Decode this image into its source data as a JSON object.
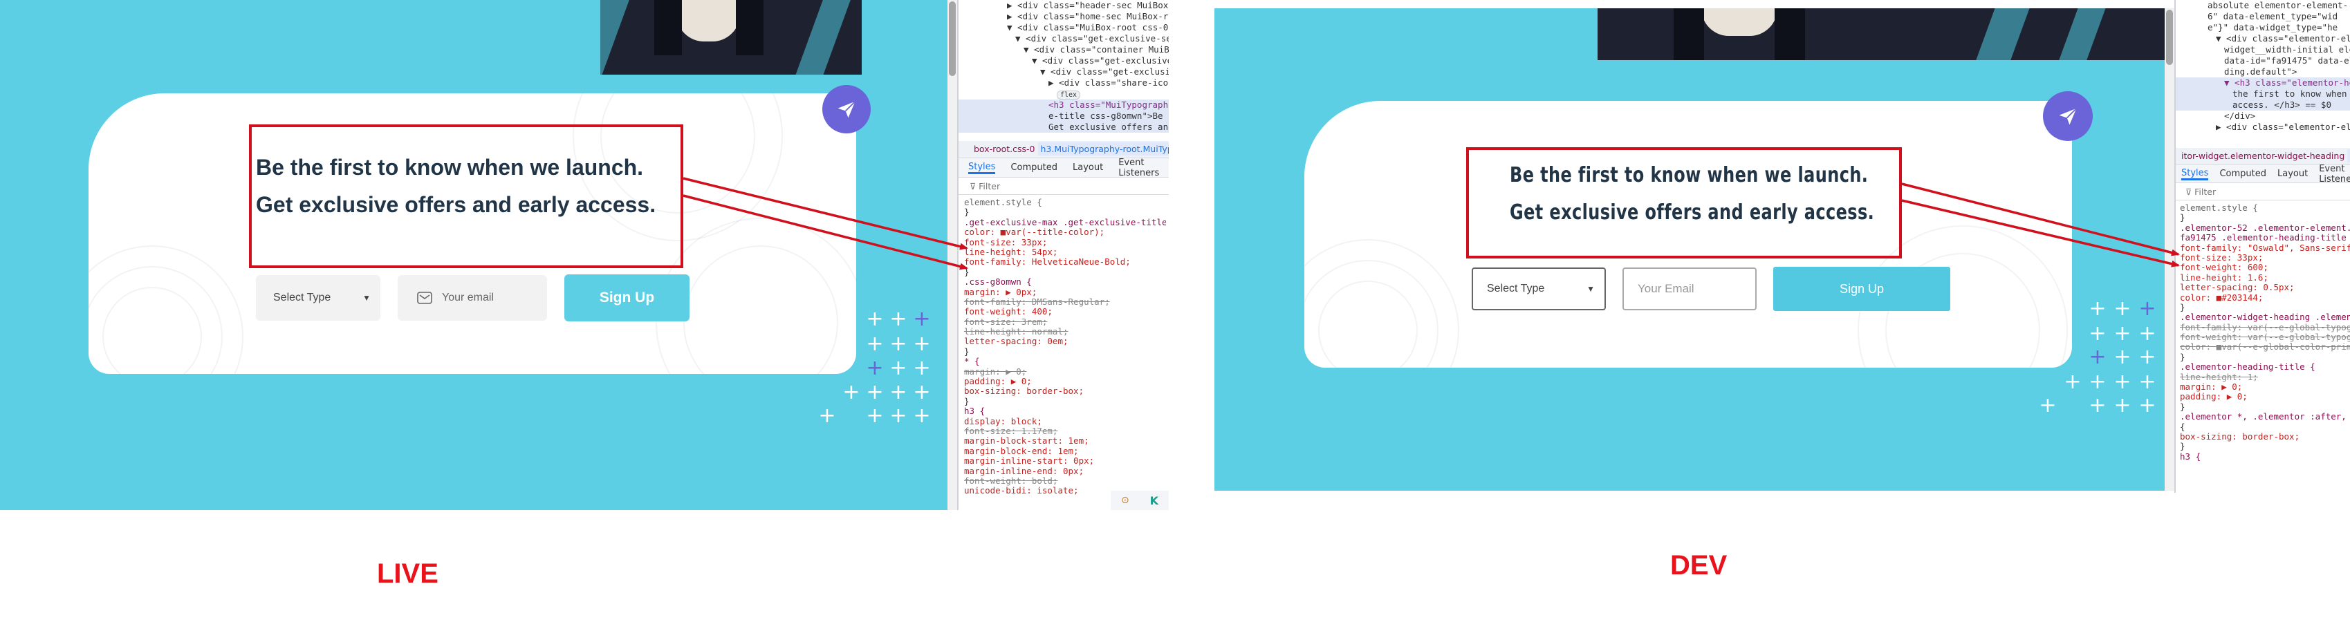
{
  "colors": {
    "hero_bg": "#5ccfe4",
    "accent_purple": "#6b63d8",
    "signup_live": "#5ccfe4",
    "signup_dev": "#53c9e1",
    "annotation_red": "#d0101c",
    "headline": "#213547"
  },
  "live": {
    "caption": "LIVE",
    "headline_line1": "Be the first to know when we launch.",
    "headline_line2": "Get exclusive offers and early access.",
    "select_label": "Select Type",
    "email_placeholder": "Your email",
    "signup_label": "Sign Up",
    "share_icon": "paper-plane-icon",
    "devtools": {
      "dom_lines": [
        "▶ <div class=\"header-sec MuiBox-root",
        "▶ <div class=\"home-sec MuiBox-root c",
        "▼ <div class=\"MuiBox-root css-0\" id=",
        "▼ <div class=\"get-exclusive-sec Mu",
        "▼ <div class=\"container MuiBox-ro",
        "▼ <div class=\"get-exclusive-m",
        "▼ <div class=\"get-exclusive-",
        "▶ <div class=\"share-icon-bo",
        "flex",
        "<h3 class=\"MuiTypography-",
        "e-title css-g8omwn\">Be th",
        "Get exclusive offers and"
      ],
      "crumb_left": "box-root.css-0",
      "crumb_right": "h3.MuiTypography-root.MuiTypogr",
      "tabs": [
        "Styles",
        "Computed",
        "Layout",
        "Event Listeners"
      ],
      "filter_label": "Filter",
      "style_lines": [
        "element.style {",
        "}",
        ".get-exclusive-max .get-exclusive-title {",
        "  color: ■var(--title-color);",
        "  font-size: 33px;",
        "  line-height: 54px;",
        "  font-family: HelveticaNeue-Bold;",
        "}",
        ".css-g8omwn {",
        "  margin: ▶ 0px;",
        "  font-family: DMSans-Regular;",
        "  font-weight: 400;",
        "  font-size: 3rem;",
        "  line-height: normal;",
        "  letter-spacing: 0em;",
        "}",
        "* {",
        "  margin: ▶ 0;",
        "  padding: ▶ 0;",
        "  box-sizing: border-box;",
        "}",
        "h3 {",
        "  display: block;",
        "  font-size: 1.17em;",
        "  margin-block-start: 1em;",
        "  margin-block-end: 1em;",
        "  margin-inline-start: 0px;",
        "  margin-inline-end: 0px;",
        "  font-weight: bold;",
        "  unicode-bidi: isolate;"
      ]
    }
  },
  "dev": {
    "caption": "DEV",
    "headline_line1": "Be the first to know when we launch.",
    "headline_line2": "Get exclusive offers and early access.",
    "select_label": "Select Type",
    "email_placeholder": "Your Email",
    "signup_label": "Sign Up",
    "share_icon": "paper-plane-icon",
    "devtools": {
      "dom_lines": [
        "absolute elementor-element-",
        "6\" data-element_type=\"wid",
        "e\"}\" data-widget_type=\"he",
        "▼ <div class=\"elementor-ele",
        "widget__width-initial ele",
        "data-id=\"fa91475\" data-el",
        "ding.default\">",
        "▼ <h3 class=\"elementor-head",
        "the first to know when w",
        "access. </h3> == $0",
        "</div>",
        "▶ <div class=\"elementor-ele"
      ],
      "crumb_left": "itor-widget.elementor-widget-heading",
      "crumb_right": "h3",
      "tabs": [
        "Styles",
        "Computed",
        "Layout",
        "Event Listeners"
      ],
      "filter_label": "Filter",
      "style_lines": [
        "element.style {",
        "}",
        ".elementor-52 .elementor-element.eleme",
        "fa91475 .elementor-heading-title {",
        "  font-family: \"Oswald\", Sans-serif;",
        "  font-size: 33px;",
        "  font-weight: 600;",
        "  line-height: 1.6;",
        "  letter-spacing: 0.5px;",
        "  color: ■#203144;",
        "}",
        ".elementor-widget-heading .elementor-h",
        "  font-family: var(--e-global-typogra",
        "  font-weight: var(--e-global-typogra",
        "  color: ■var(--e-global-color-primar",
        "}",
        ".elementor-heading-title {",
        "  line-height: 1;",
        "  margin: ▶ 0;",
        "  padding: ▶ 0;",
        "}",
        ".elementor *, .elementor :after, .ele",
        "{",
        "  box-sizing: border-box;",
        "}",
        "h3 {"
      ]
    }
  }
}
